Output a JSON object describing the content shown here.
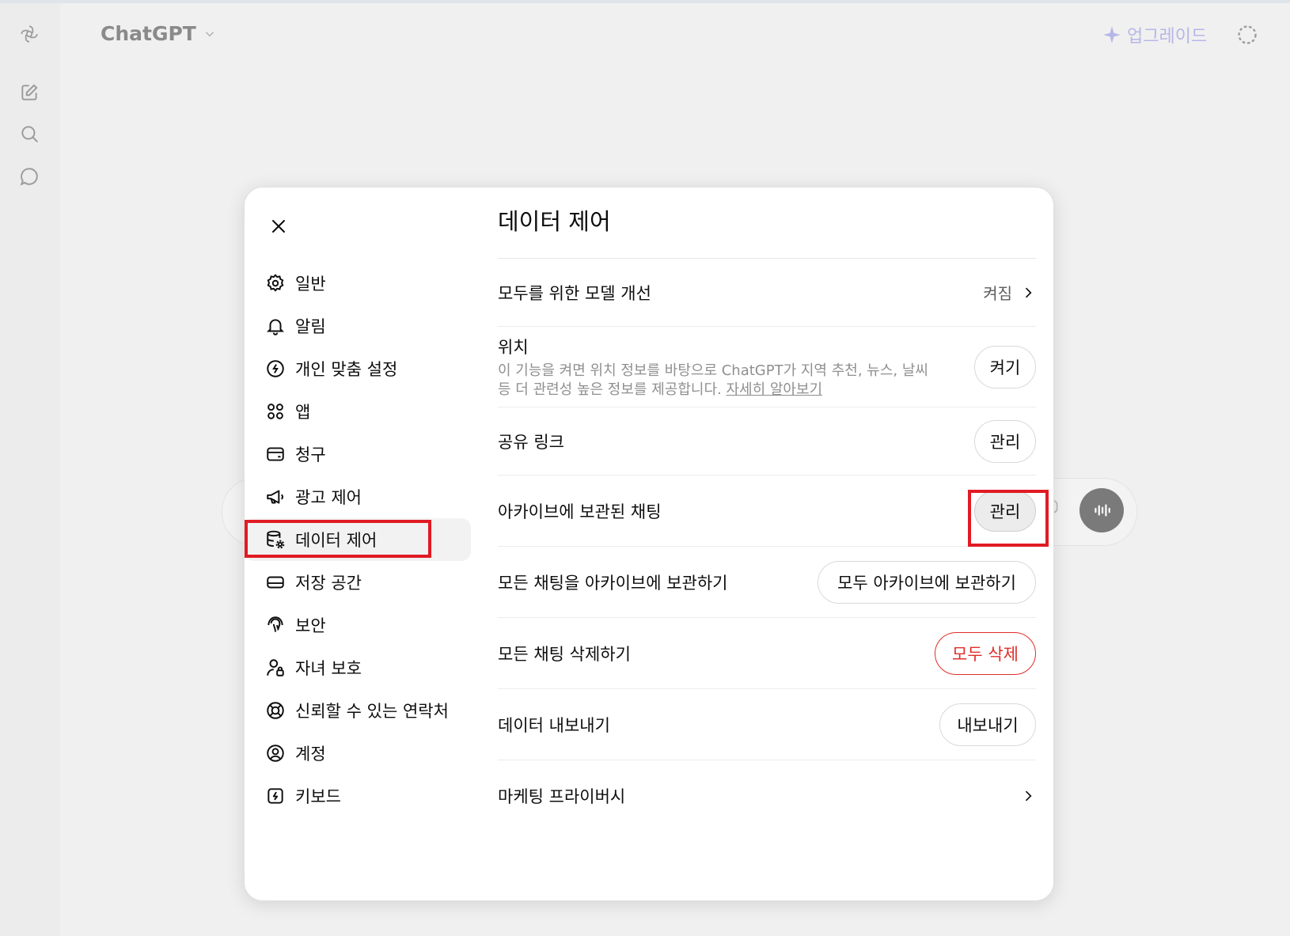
{
  "app": {
    "brand": "ChatGPT",
    "upgrade_label": "업그레이드"
  },
  "modal": {
    "title": "데이터 제어",
    "nav": [
      {
        "label": "일반",
        "icon": "gear-icon"
      },
      {
        "label": "알림",
        "icon": "bell-icon"
      },
      {
        "label": "개인 맞춤 설정",
        "icon": "personalization-icon"
      },
      {
        "label": "앱",
        "icon": "apps-icon"
      },
      {
        "label": "청구",
        "icon": "billing-card-icon"
      },
      {
        "label": "광고 제어",
        "icon": "megaphone-icon"
      },
      {
        "label": "데이터 제어",
        "icon": "database-gear-icon"
      },
      {
        "label": "저장 공간",
        "icon": "storage-icon"
      },
      {
        "label": "보안",
        "icon": "shield-security-icon"
      },
      {
        "label": "자녀 보호",
        "icon": "parental-user-icon"
      },
      {
        "label": "신뢰할 수 있는 연락처",
        "icon": "lifebuoy-icon"
      },
      {
        "label": "계정",
        "icon": "account-circle-icon"
      },
      {
        "label": "키보드",
        "icon": "keyboard-icon"
      }
    ],
    "rows": {
      "improve_model": {
        "label": "모두를 위한 모델 개선",
        "value": "켜짐"
      },
      "location": {
        "label": "위치",
        "desc_line1": "이 기능을 켜면 위치 정보를 바탕으로 ChatGPT가 지역 추천, 뉴스, 날씨",
        "desc_line2": "등 더 관련성 높은 정보를 제공합니다.",
        "learn_more": "자세히 알아보기",
        "button": "켜기"
      },
      "shared_links": {
        "label": "공유 링크",
        "button": "관리"
      },
      "archived_chats": {
        "label": "아카이브에 보관된 채팅",
        "button": "관리"
      },
      "archive_all": {
        "label": "모든 채팅을 아카이브에 보관하기",
        "button": "모두 아카이브에 보관하기"
      },
      "delete_all": {
        "label": "모든 채팅 삭제하기",
        "button": "모두 삭제"
      },
      "export": {
        "label": "데이터 내보내기",
        "button": "내보내기"
      },
      "marketing_privacy": {
        "label": "마케팅 프라이버시"
      }
    }
  },
  "colors": {
    "danger": "#e02e2a",
    "highlight_box": "#e01b24",
    "upgrade": "#b6b6e8"
  }
}
